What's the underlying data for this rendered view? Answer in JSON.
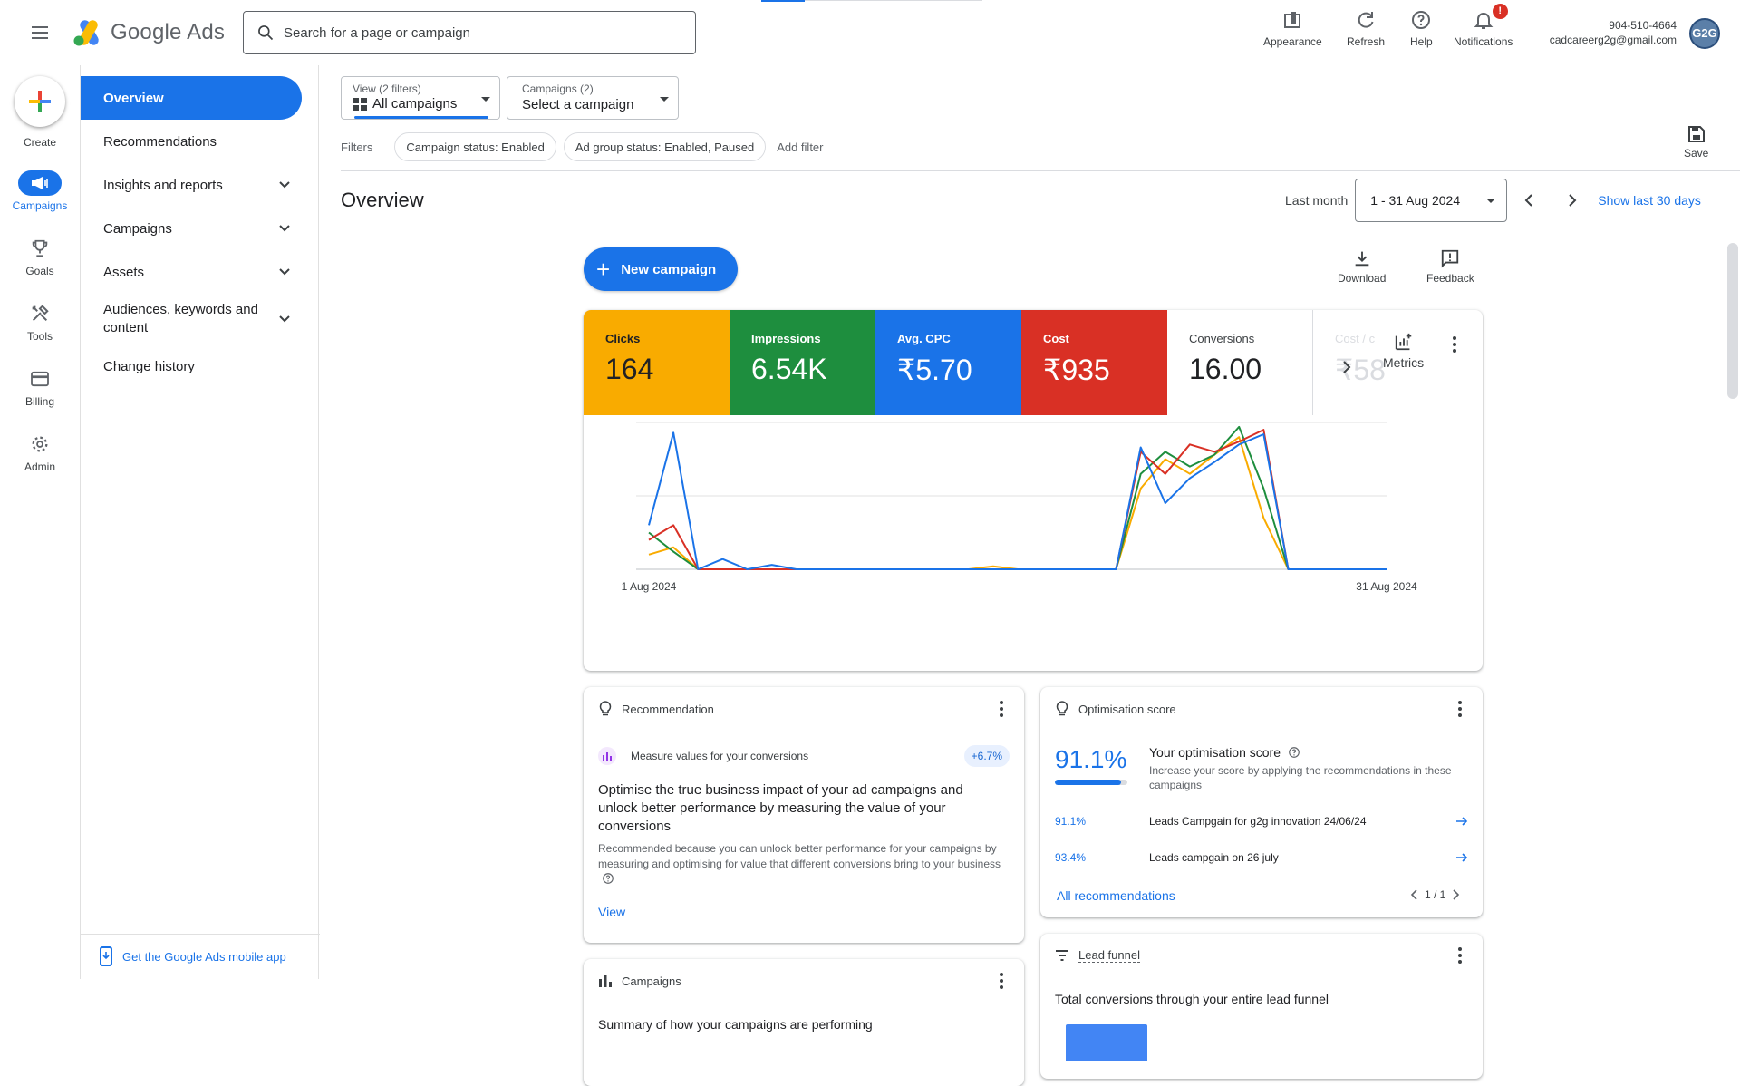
{
  "app": {
    "name": "Google Ads"
  },
  "search": {
    "placeholder": "Search for a page or campaign"
  },
  "topbar": {
    "appearance": "Appearance",
    "refresh": "Refresh",
    "help": "Help",
    "notifications": "Notifications",
    "notif_badge": "!",
    "phone": "904-510-4664",
    "email": "cadcareerg2g@gmail.com",
    "avatar_text": "G2G"
  },
  "rail": {
    "create": "Create",
    "campaigns": "Campaigns",
    "goals": "Goals",
    "tools": "Tools",
    "billing": "Billing",
    "admin": "Admin"
  },
  "nav": {
    "overview": "Overview",
    "recommendations": "Recommendations",
    "insights": "Insights and reports",
    "campaigns": "Campaigns",
    "assets": "Assets",
    "audiences_line1": "Audiences, keywords and",
    "audiences_line2": "content",
    "change_history": "Change history",
    "mobile_app": "Get the Google Ads mobile app"
  },
  "filters": {
    "view_small": "View (2 filters)",
    "view_big": "All campaigns",
    "campaigns_small": "Campaigns (2)",
    "campaigns_big": "Select a campaign",
    "label": "Filters",
    "chip1": "Campaign status: Enabled",
    "chip2": "Ad group status: Enabled, Paused",
    "add": "Add filter",
    "save": "Save"
  },
  "page": {
    "title": "Overview",
    "date_label": "Last month",
    "date_range": "1 - 31 Aug 2024",
    "show_last": "Show last 30 days",
    "new_campaign": "New campaign",
    "download": "Download",
    "feedback": "Feedback"
  },
  "metrics": [
    {
      "name": "Clicks",
      "value": "164",
      "color": "#f9ab00"
    },
    {
      "name": "Impressions",
      "value": "6.54K",
      "color": "#1e8e3e"
    },
    {
      "name": "Avg. CPC",
      "value": "₹5.70",
      "color": "#1a73e8"
    },
    {
      "name": "Cost",
      "value": "₹935",
      "color": "#d93025"
    },
    {
      "name": "Conversions",
      "value": "16.00",
      "color": "#ffffff"
    },
    {
      "name": "Cost / c",
      "value": "₹58",
      "color": "#ffffff"
    }
  ],
  "metrics_button": "Metrics",
  "chart_data": {
    "type": "line",
    "x": [
      "1 Aug",
      "2 Aug",
      "3 Aug",
      "4 Aug",
      "5 Aug",
      "6 Aug",
      "7 Aug",
      "8 Aug",
      "9 Aug",
      "10 Aug",
      "11 Aug",
      "12 Aug",
      "13 Aug",
      "14 Aug",
      "15 Aug",
      "16 Aug",
      "17 Aug",
      "18 Aug",
      "19 Aug",
      "20 Aug",
      "21 Aug",
      "22 Aug",
      "23 Aug",
      "24 Aug",
      "25 Aug",
      "26 Aug",
      "27 Aug",
      "28 Aug",
      "29 Aug",
      "30 Aug",
      "31 Aug"
    ],
    "x_tick_labels": [
      "1 Aug 2024",
      "31 Aug 2024"
    ],
    "grid": true,
    "series": [
      {
        "color": "#1a73e8",
        "values": [
          0.3,
          0.93,
          0.0,
          0.07,
          0.0,
          0.03,
          0.0,
          0.0,
          0.0,
          0.0,
          0.0,
          0.0,
          0.0,
          0.0,
          0.0,
          0.0,
          0.0,
          0.0,
          0.0,
          0.0,
          0.83,
          0.45,
          0.62,
          0.73,
          0.85,
          0.92,
          0.0,
          0.0,
          0.0,
          0.0,
          0.0
        ]
      },
      {
        "color": "#d93025",
        "values": [
          0.2,
          0.3,
          0.0,
          0.0,
          0.0,
          0.0,
          0.0,
          0.0,
          0.0,
          0.0,
          0.0,
          0.0,
          0.0,
          0.0,
          0.0,
          0.0,
          0.0,
          0.0,
          0.0,
          0.0,
          0.8,
          0.65,
          0.85,
          0.8,
          0.87,
          0.95,
          0.0,
          0.0,
          0.0,
          0.0,
          0.0
        ]
      },
      {
        "color": "#1e8e3e",
        "values": [
          0.25,
          0.12,
          0.0,
          0.0,
          0.0,
          0.0,
          0.0,
          0.0,
          0.0,
          0.0,
          0.0,
          0.0,
          0.0,
          0.0,
          0.0,
          0.0,
          0.0,
          0.0,
          0.0,
          0.0,
          0.65,
          0.8,
          0.7,
          0.78,
          0.97,
          0.55,
          0.0,
          0.0,
          0.0,
          0.0,
          0.0
        ]
      },
      {
        "color": "#f9ab00",
        "values": [
          0.1,
          0.15,
          0.0,
          0.0,
          0.0,
          0.0,
          0.0,
          0.0,
          0.0,
          0.0,
          0.0,
          0.0,
          0.0,
          0.0,
          0.02,
          0.0,
          0.0,
          0.0,
          0.0,
          0.0,
          0.55,
          0.75,
          0.65,
          0.78,
          0.9,
          0.35,
          0.0,
          0.0,
          0.0,
          0.0,
          0.0
        ]
      }
    ]
  },
  "recommendation": {
    "header": "Recommendation",
    "item_title": "Measure values for your conversions",
    "badge": "+6.7%",
    "headline": "Optimise the true business impact of your ad campaigns and unlock better performance by measuring the value of your conversions",
    "body": "Recommended because you can unlock better performance for your campaigns by measuring and optimising for value that different conversions bring to your business",
    "view": "View"
  },
  "optimisation": {
    "header": "Optimisation score",
    "score": "91.1%",
    "score_fraction": 0.911,
    "title": "Your optimisation score",
    "desc": "Increase your score by applying the recommendations in these campaigns",
    "rows": [
      {
        "score": "91.1%",
        "name": "Leads Campgain for g2g innovation 24/06/24"
      },
      {
        "score": "93.4%",
        "name": "Leads campgain on 26 july"
      }
    ],
    "all_link": "All recommendations",
    "pager": "1 / 1"
  },
  "campaigns_card": {
    "header": "Campaigns",
    "subtitle": "Summary of how your campaigns are performing"
  },
  "lead_funnel": {
    "header": "Lead funnel",
    "subtitle": "Total conversions through your entire lead funnel"
  }
}
